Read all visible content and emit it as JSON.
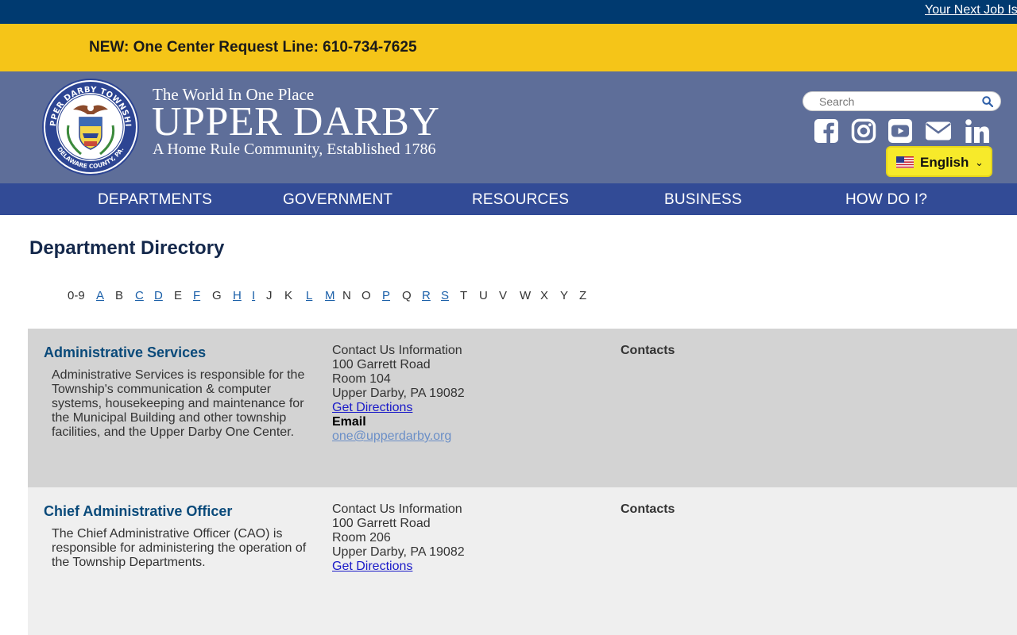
{
  "topbar": {
    "link": "Your Next Job Is"
  },
  "alert": {
    "text": "NEW: One Center Request Line: 610-734-7625"
  },
  "header": {
    "tagline": "The World In One Place",
    "name": "UPPER DARBY",
    "subtitle": "A Home Rule Community, Established 1786",
    "seal_icon": "township-seal-logo",
    "seal_text": {
      "top": "UPPER DARBY TOWNSHIP",
      "bottom": "DELAWARE COUNTY, PA."
    },
    "search_placeholder": "Search",
    "social_icons": [
      "facebook-icon",
      "instagram-icon",
      "youtube-icon",
      "email-icon",
      "linkedin-icon"
    ],
    "language": "English"
  },
  "nav": {
    "items": [
      {
        "label": "DEPARTMENTS"
      },
      {
        "label": "GOVERNMENT"
      },
      {
        "label": "RESOURCES"
      },
      {
        "label": "BUSINESS"
      },
      {
        "label": "HOW DO I?"
      }
    ]
  },
  "main": {
    "title": "Department Directory",
    "alphabet": [
      {
        "l": "0-9",
        "link": false
      },
      {
        "l": "A",
        "link": true
      },
      {
        "l": "B",
        "link": false
      },
      {
        "l": "C",
        "link": true
      },
      {
        "l": "D",
        "link": true
      },
      {
        "l": "E",
        "link": false
      },
      {
        "l": "F",
        "link": true
      },
      {
        "l": "G",
        "link": false
      },
      {
        "l": "H",
        "link": true
      },
      {
        "l": "I",
        "link": true
      },
      {
        "l": "J",
        "link": false
      },
      {
        "l": "K",
        "link": false
      },
      {
        "l": "L",
        "link": true
      },
      {
        "l": "M",
        "link": true
      },
      {
        "l": "N",
        "link": false
      },
      {
        "l": "O",
        "link": false
      },
      {
        "l": "P",
        "link": true
      },
      {
        "l": "Q",
        "link": false
      },
      {
        "l": "R",
        "link": true
      },
      {
        "l": "S",
        "link": true
      },
      {
        "l": "T",
        "link": false
      },
      {
        "l": "U",
        "link": false
      },
      {
        "l": "V",
        "link": false
      },
      {
        "l": "W",
        "link": false
      },
      {
        "l": "X",
        "link": false
      },
      {
        "l": "Y",
        "link": false
      },
      {
        "l": "Z",
        "link": false
      }
    ],
    "departments": [
      {
        "name": "Administrative Services",
        "description": "Administrative Services is responsible for the Township's communication & computer systems, housekeeping and maintenance for the Municipal Building and other township facilities, and the Upper Darby One Center.",
        "contact_heading": "Contact Us Information",
        "address1": "100 Garrett Road",
        "address2": "Room 104",
        "city": "Upper Darby, PA 19082",
        "directions": "Get Directions",
        "email_label": "Email",
        "email": "one@upperdarby.org",
        "contacts_heading": "Contacts"
      },
      {
        "name": "Chief Administrative Officer",
        "description": "The Chief Administrative Officer (CAO) is responsible for administering the operation of the Township Departments.",
        "contact_heading": "Contact Us Information",
        "address1": "100 Garrett Road",
        "address2": "Room 206",
        "city": "Upper Darby, PA 19082",
        "directions": "Get Directions",
        "contacts_heading": "Contacts"
      }
    ]
  },
  "colors": {
    "topbar": "#003a70",
    "alert": "#f5c518",
    "header": "#5e6e99",
    "nav": "#324b96",
    "row_odd": "#d3d3d3",
    "row_even": "#efefef",
    "dept_title": "#0a4a7a"
  }
}
